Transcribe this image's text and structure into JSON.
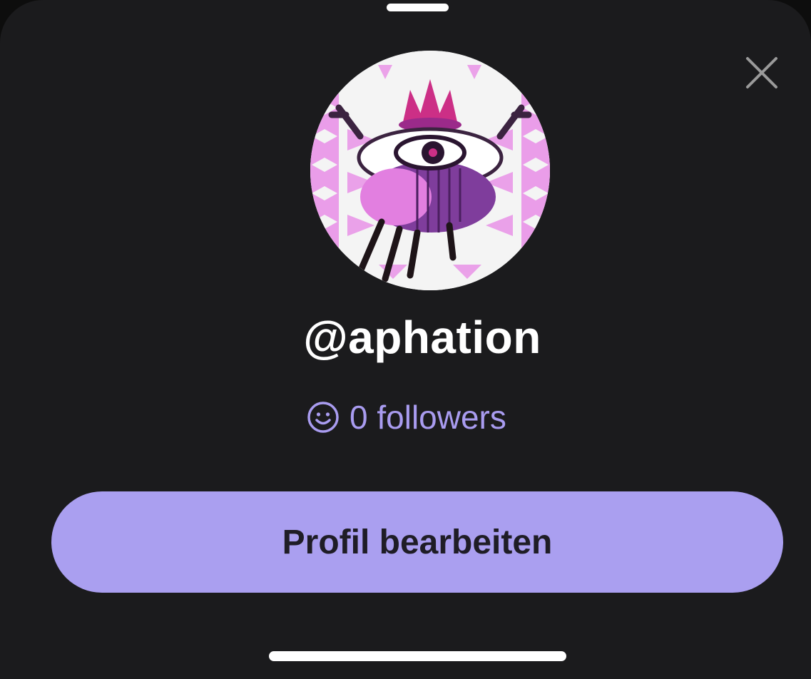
{
  "profile": {
    "username": "@aphation",
    "followers_label": "0 followers",
    "avatar_icon": "creature-avatar"
  },
  "actions": {
    "edit_profile_label": "Profil bearbeiten",
    "close_icon": "close-icon"
  },
  "colors": {
    "background": "#1b1b1d",
    "accent": "#aa9ff0",
    "followers_text": "#a99cf0",
    "button_text": "#1f1d26"
  }
}
